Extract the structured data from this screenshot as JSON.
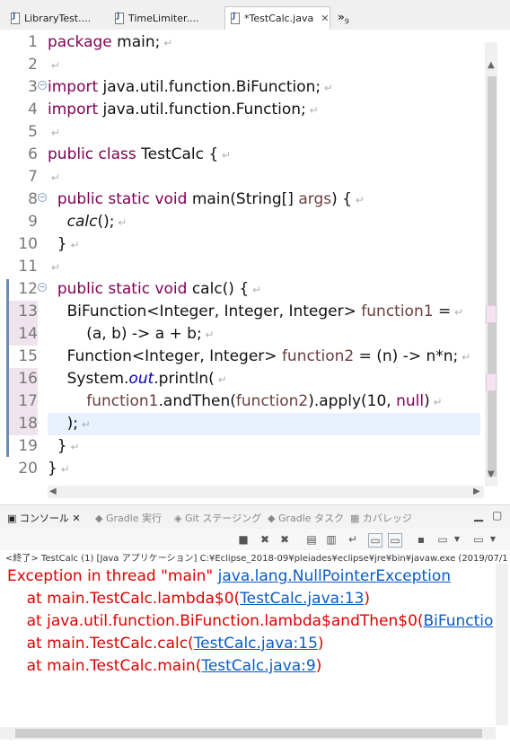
{
  "editor_tabs": [
    {
      "label": "LibraryTest....",
      "active": false
    },
    {
      "label": "TimeLimiter....",
      "active": false
    },
    {
      "label": "*TestCalc.java",
      "active": true
    }
  ],
  "tab_overflow": "»",
  "tab_overflow_count": "9",
  "code_lines": [
    {
      "num": "1",
      "tokens": [
        {
          "t": "package",
          "c": "kw"
        },
        {
          "t": " main;"
        }
      ]
    },
    {
      "num": "2",
      "tokens": []
    },
    {
      "num": "3",
      "fold": true,
      "tokens": [
        {
          "t": "import",
          "c": "kw"
        },
        {
          "t": " java.util.function.BiFunction;"
        }
      ]
    },
    {
      "num": "4",
      "tokens": [
        {
          "t": "import",
          "c": "kw"
        },
        {
          "t": " java.util.function.Function;"
        }
      ]
    },
    {
      "num": "5",
      "tokens": []
    },
    {
      "num": "6",
      "tokens": [
        {
          "t": "public class",
          "c": "kw"
        },
        {
          "t": " TestCalc {"
        }
      ]
    },
    {
      "num": "7",
      "tokens": []
    },
    {
      "num": "8",
      "fold": true,
      "tokens": [
        {
          "t": "  "
        },
        {
          "t": "public static void",
          "c": "kw"
        },
        {
          "t": " main(String[] "
        },
        {
          "t": "args",
          "c": "var"
        },
        {
          "t": ") {"
        }
      ]
    },
    {
      "num": "9",
      "tokens": [
        {
          "t": "    "
        },
        {
          "t": "calc",
          "c": "it"
        },
        {
          "t": "();"
        }
      ]
    },
    {
      "num": "10",
      "tokens": [
        {
          "t": "  }"
        }
      ]
    },
    {
      "num": "11",
      "tokens": []
    },
    {
      "num": "12",
      "fold": true,
      "tokens": [
        {
          "t": "  "
        },
        {
          "t": "public static void",
          "c": "kw"
        },
        {
          "t": " calc() {"
        }
      ]
    },
    {
      "num": "13",
      "qd": true,
      "tokens": [
        {
          "t": "    BiFunction<Integer, Integer, Integer> "
        },
        {
          "t": "function1",
          "c": "var"
        },
        {
          "t": " ="
        }
      ]
    },
    {
      "num": "14",
      "qd": true,
      "tokens": [
        {
          "t": "        (a, b) -> a + b;"
        }
      ]
    },
    {
      "num": "15",
      "tokens": [
        {
          "t": "    Function<Integer, Integer> "
        },
        {
          "t": "function2",
          "c": "var"
        },
        {
          "t": " = (n) -> n*n;"
        }
      ]
    },
    {
      "num": "16",
      "qd": true,
      "tokens": [
        {
          "t": "    System."
        },
        {
          "t": "out",
          "c": "fld"
        },
        {
          "t": ".println("
        }
      ]
    },
    {
      "num": "17",
      "qd": true,
      "tokens": [
        {
          "t": "        "
        },
        {
          "t": "function1",
          "c": "var"
        },
        {
          "t": ".andThen("
        },
        {
          "t": "function2",
          "c": "var"
        },
        {
          "t": ").apply(10, "
        },
        {
          "t": "null",
          "c": "kw"
        },
        {
          "t": ")"
        }
      ]
    },
    {
      "num": "18",
      "qd": true,
      "current": true,
      "tokens": [
        {
          "t": "    );"
        }
      ]
    },
    {
      "num": "19",
      "tokens": [
        {
          "t": "  }"
        }
      ]
    },
    {
      "num": "20",
      "tokens": [
        {
          "t": "}"
        }
      ]
    }
  ],
  "console_tabs": [
    {
      "label": "コンソール",
      "active": true
    },
    {
      "label": "Gradle 実行",
      "active": false
    },
    {
      "label": "Git ステージング",
      "active": false
    },
    {
      "label": "Gradle タスク",
      "active": false
    },
    {
      "label": "カバレッジ",
      "active": false
    }
  ],
  "status_line": "<終了> TestCalc (1) [Java アプリケーション] C:¥Eclipse_2018-09¥pleiades¥eclipse¥jre¥bin¥javaw.exe (2019/07/1",
  "console_lines": [
    {
      "parts": [
        {
          "t": "Exception in thread \"main\" "
        },
        {
          "t": "java.lang.NullPointerException",
          "link": true
        }
      ]
    },
    {
      "parts": [
        {
          "t": "    at main.TestCalc.lambda$0("
        },
        {
          "t": "TestCalc.java:13",
          "link": true
        },
        {
          "t": ")"
        }
      ]
    },
    {
      "parts": [
        {
          "t": "    at java.util.function.BiFunction.lambda$andThen$0("
        },
        {
          "t": "BiFunctio",
          "link": true
        }
      ]
    },
    {
      "parts": [
        {
          "t": "    at main.TestCalc.calc("
        },
        {
          "t": "TestCalc.java:15",
          "link": true
        },
        {
          "t": ")"
        }
      ]
    },
    {
      "parts": [
        {
          "t": "    at main.TestCalc.main("
        },
        {
          "t": "TestCalc.java:9",
          "link": true
        },
        {
          "t": ")"
        }
      ]
    }
  ],
  "colors": {
    "keyword": "#7f0055",
    "variable": "#6a3e3e",
    "field": "#0000c0",
    "error": "#e00000",
    "link": "#0a5bc4"
  }
}
